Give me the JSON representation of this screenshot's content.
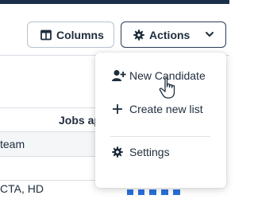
{
  "toolbar": {
    "columns_label": "Columns",
    "actions_label": "Actions"
  },
  "actions_menu": {
    "items": [
      {
        "label": "New Candidate",
        "icon": "user-plus-icon"
      },
      {
        "label": "Create new list",
        "icon": "plus-icon"
      },
      {
        "label": "Settings",
        "icon": "gear-icon"
      }
    ]
  },
  "table": {
    "header_label": "Jobs ap",
    "rows": [
      "team",
      "CTA, HD"
    ]
  },
  "colors": {
    "topbar": "#1c2f4a",
    "text": "#1f2d3d",
    "border": "#b9c2cc",
    "icon_blue": "#2a6fdb"
  }
}
